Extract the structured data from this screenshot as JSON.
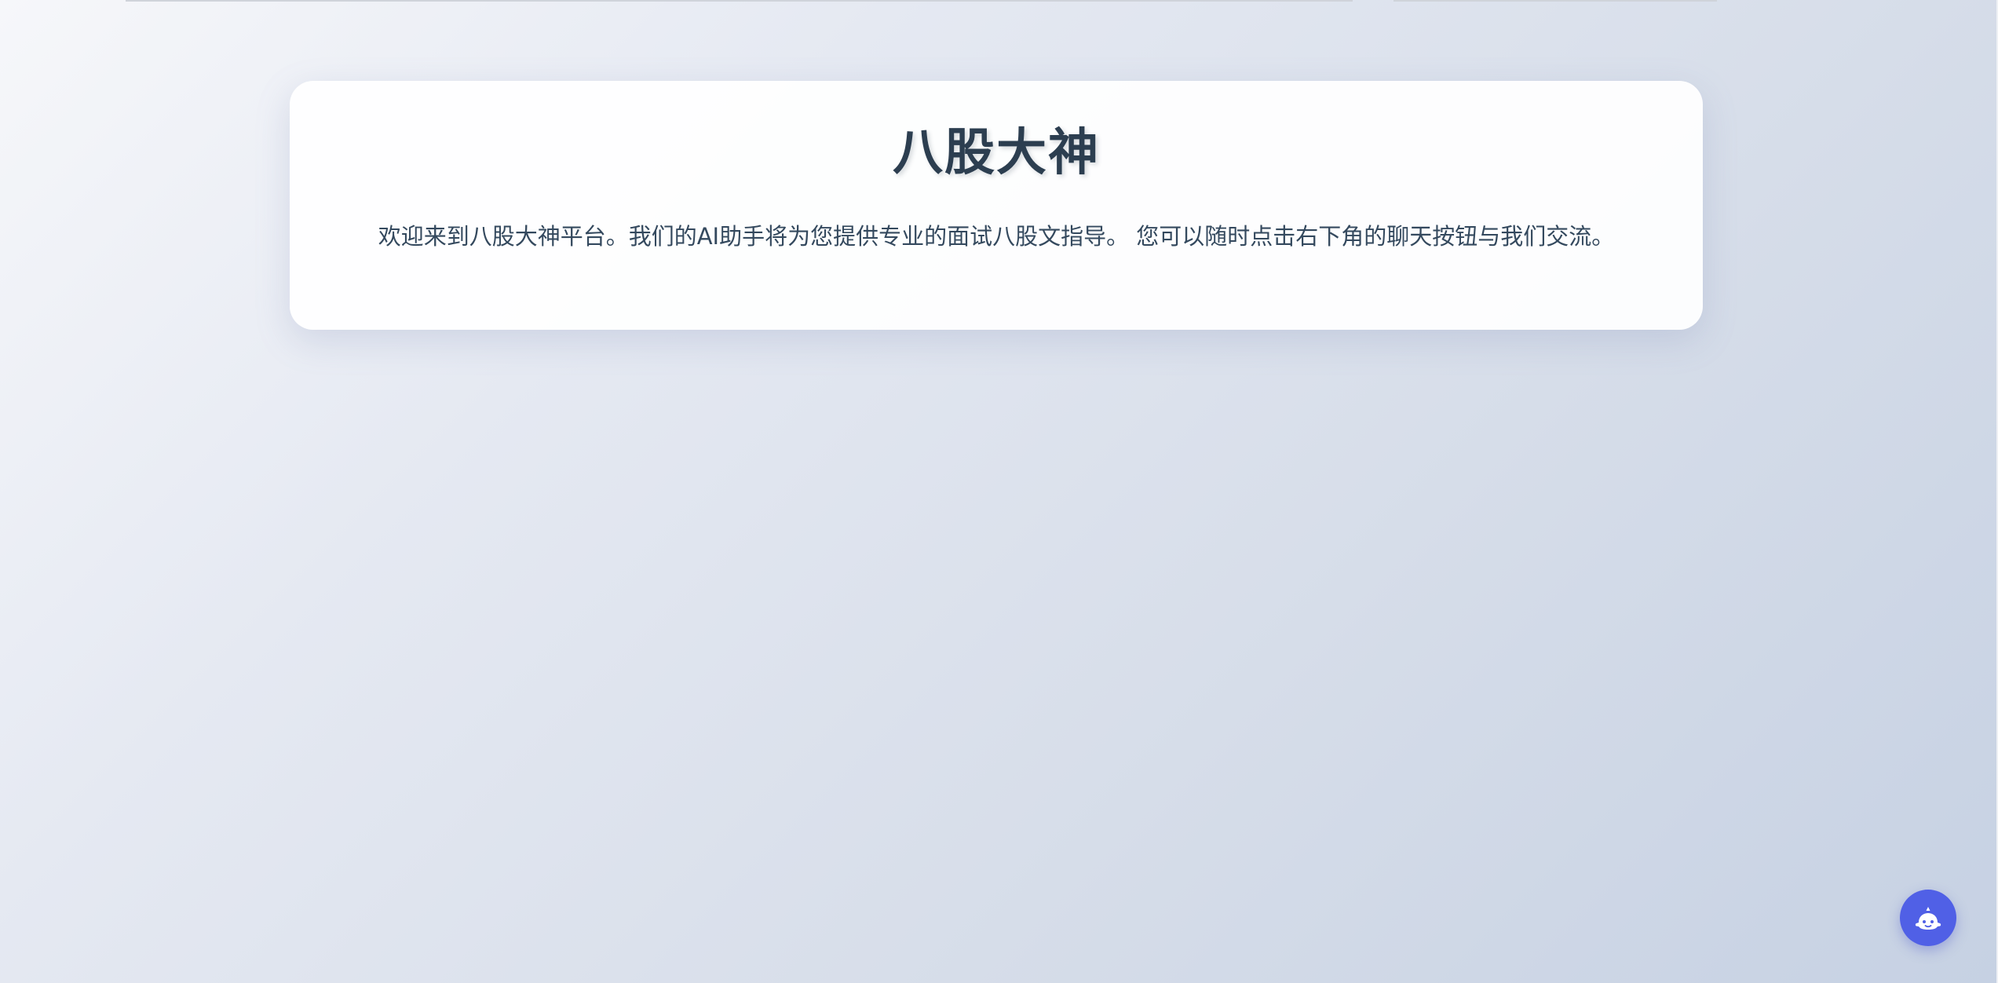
{
  "page": {
    "title": "八股大神",
    "description": "欢迎来到八股大神平台。我们的AI助手将为您提供专业的面试八股文指导。 您可以随时点击右下角的聊天按钮与我们交流。"
  },
  "chat_widget": {
    "icon": "robot-face-icon",
    "accent_color": "#5060e6"
  }
}
